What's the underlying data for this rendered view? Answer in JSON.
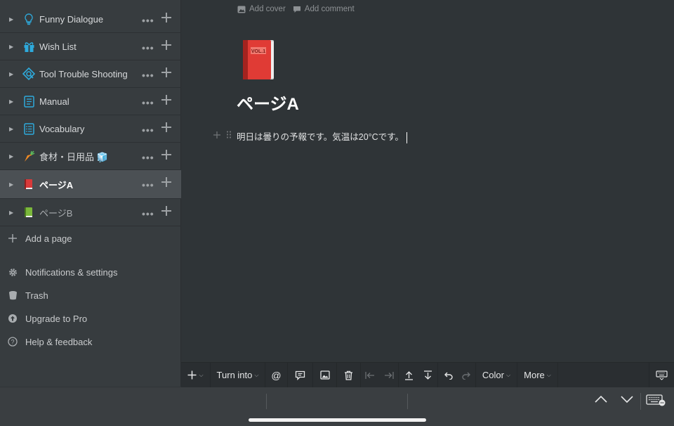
{
  "sidebar": {
    "pages": [
      {
        "label": "Funny Dialogue",
        "icon": "lightbulb-icon"
      },
      {
        "label": "Wish List",
        "icon": "gift-icon"
      },
      {
        "label": "Tool Trouble Shooting",
        "icon": "tool-icon"
      },
      {
        "label": "Manual",
        "icon": "document-icon"
      },
      {
        "label": "Vocabulary",
        "icon": "list-icon"
      },
      {
        "label": "食材・日用品 🧊",
        "icon": "carrot-icon"
      },
      {
        "label": "ページA",
        "icon": "red-book-icon"
      },
      {
        "label": "ページB",
        "icon": "green-book-icon"
      }
    ],
    "add_page": "Add a page",
    "notifications": "Notifications & settings",
    "trash": "Trash",
    "upgrade": "Upgrade to Pro",
    "help": "Help & feedback"
  },
  "page": {
    "add_cover": "Add cover",
    "add_comment": "Add comment",
    "title": "ページA",
    "block_text": "明日は曇りの予報です。気温は20°Cです。"
  },
  "toolbar": {
    "turn_into": "Turn into",
    "mention": "@",
    "color": "Color",
    "more": "More"
  },
  "colors": {
    "sidebar_bg": "#373c3f",
    "main_bg": "#2f3437",
    "active_item_bg": "#4b5054",
    "accent_blue": "#2eaadc"
  }
}
